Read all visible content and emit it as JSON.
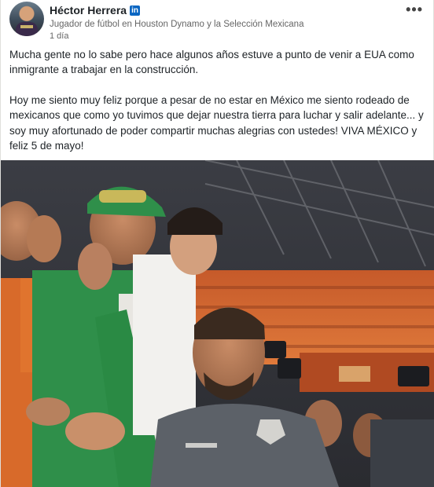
{
  "post": {
    "author": {
      "name": "Héctor Herrera",
      "headline": "Jugador de fútbol en Houston Dynamo y la Selección Mexicana",
      "time": "1 día",
      "badge_icon": "linkedin-icon",
      "badge_glyph": "in"
    },
    "menu_glyph": "•••",
    "paragraphs": [
      "Mucha gente no lo sabe pero hace algunos años estuve a punto de venir a EUA como inmigrante a trabajar en la construcción.",
      "Hoy me siento muy feliz porque a pesar de no estar en México me siento rodeado de mexicanos que como yo tuvimos que dejar nuestra tierra para luchar y salir adelante... y soy muy afortunado de poder compartir muchas alegrias con ustedes! VIVA MÉXICO y feliz 5 de mayo!"
    ],
    "colors": {
      "brand": "#0a66c2",
      "stadium_orange": "#d9622b"
    }
  }
}
